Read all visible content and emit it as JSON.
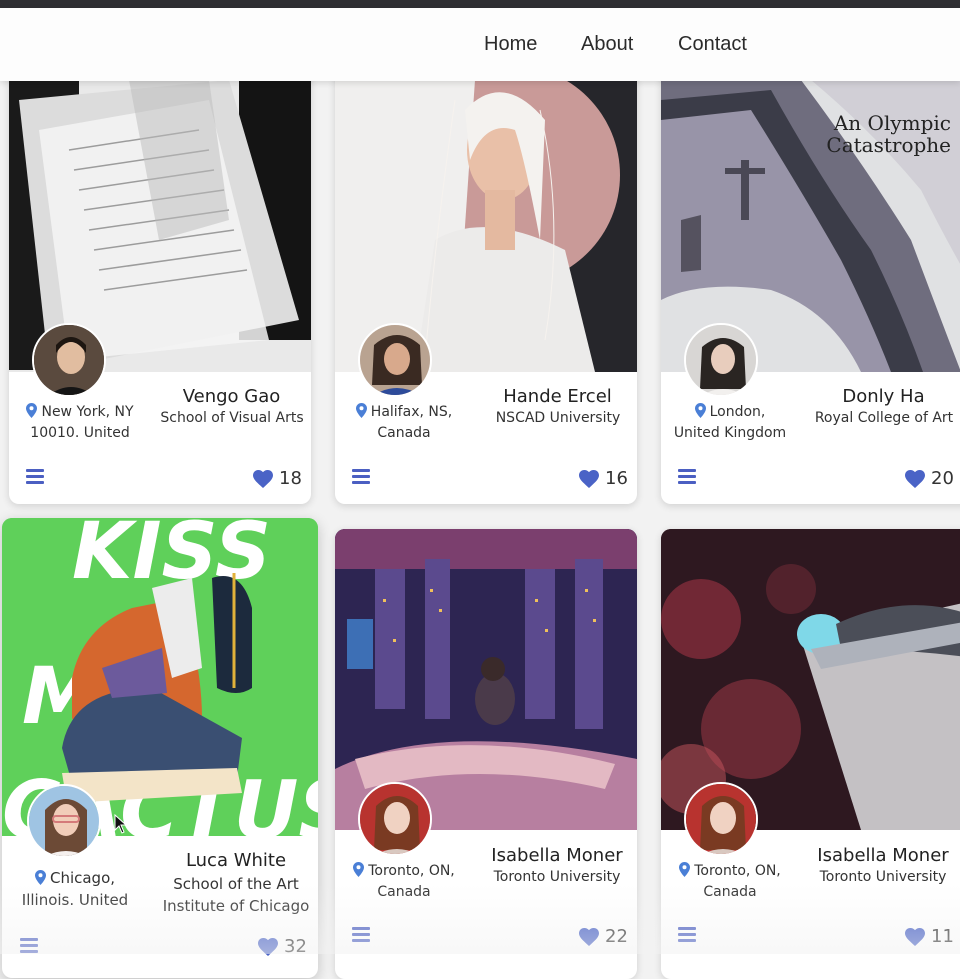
{
  "nav": {
    "home": "Home",
    "about": "About",
    "contact": "Contact"
  },
  "cards": [
    {
      "name": "Vengo Gao",
      "school": "School of Visual Arts",
      "location": [
        "New York, NY",
        "10010. United"
      ],
      "likes": "18"
    },
    {
      "name": "Hande Ercel",
      "school": "NSCAD University",
      "location": [
        "Halifax, NS,",
        "Canada"
      ],
      "likes": "16"
    },
    {
      "name": "Donly Ha",
      "school": "Royal College of Art",
      "location": [
        "London,",
        "United Kingdom"
      ],
      "likes": "20",
      "art_title": [
        "An Olympic",
        "Catastrophe"
      ]
    },
    {
      "name": "Luca White",
      "school": [
        "School of the Art",
        "Institute of Chicago"
      ],
      "location": [
        "Chicago,",
        "Illinois. United"
      ],
      "likes": "32",
      "art_title": [
        "KISS",
        "MY",
        "CACTUS"
      ]
    },
    {
      "name": "Isabella Moner",
      "school": "Toronto University",
      "location": [
        "Toronto, ON,",
        "Canada"
      ],
      "likes": "22"
    },
    {
      "name": "Isabella Moner",
      "school": "Toronto University",
      "location": [
        "Toronto, ON,",
        "Canada"
      ],
      "likes": "11"
    }
  ],
  "colors": {
    "accent": "#4b5fc2",
    "heart": "#4a63c6",
    "pin": "#4a7fd6",
    "cactus_green": "#5fd05a"
  }
}
